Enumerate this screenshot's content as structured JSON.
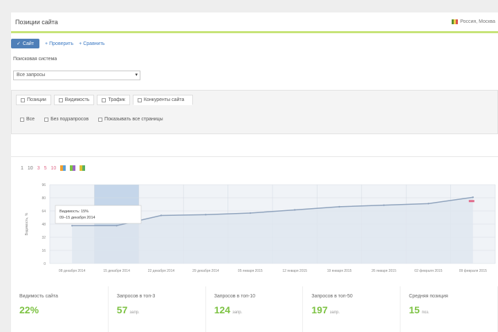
{
  "header": {
    "title": "Позиции сайта",
    "right_text": "Россия, Москва"
  },
  "toolbar": {
    "primary_label": "Сайт",
    "link1_label": "Проверить",
    "link2_label": "Сравнить"
  },
  "filter": {
    "label": "Поисковая система",
    "select_value": "Все запросы",
    "tabs": [
      {
        "label": "Позиции"
      },
      {
        "label": "Видимость"
      },
      {
        "label": "Трафик"
      },
      {
        "label": "Конкуренты сайта"
      }
    ],
    "options": [
      {
        "label": "Все"
      },
      {
        "label": "Без подзапросов"
      },
      {
        "label": "Показывать все страницы"
      }
    ]
  },
  "legend": {
    "items": [
      "1",
      "10",
      "3",
      "5",
      "10"
    ]
  },
  "tooltip": {
    "line1": "Видимость: 15%",
    "line2": "09–15 декабря 2014"
  },
  "chart_data": {
    "type": "area",
    "ylabel": "Видимость, %",
    "ylim": [
      0,
      100
    ],
    "yticks": [
      "0",
      "16",
      "32",
      "48",
      "64",
      "80",
      "96"
    ],
    "x": [
      "08 декабря 2014",
      "15 декабря 2014",
      "22 декабря 2014",
      "29 декабря 2014",
      "05 января 2015",
      "12 января 2015",
      "19 января 2015",
      "26 января 2015",
      "02 февраля 2015",
      "09 февраля 2015"
    ],
    "series": [
      {
        "values": [
          48,
          48,
          61,
          62,
          64,
          68,
          72,
          74,
          76,
          84
        ]
      }
    ],
    "highlight_index": 1,
    "colors": {
      "line": "#8fa3bd",
      "area": "#dfe6ef",
      "highlight": "#c5d6ea",
      "marker": "#e06b8a"
    }
  },
  "stats": [
    {
      "label": "Видимость сайта",
      "value": "22%",
      "unit": ""
    },
    {
      "label": "Запросов в топ-3",
      "value": "57",
      "unit": "запр."
    },
    {
      "label": "Запросов в топ-10",
      "value": "124",
      "unit": "запр."
    },
    {
      "label": "Запросов в топ-50",
      "value": "197",
      "unit": "запр."
    },
    {
      "label": "Средняя позиция",
      "value": "15",
      "unit": "поз."
    }
  ],
  "colors": {
    "accent_green": "#c6e377",
    "primary_blue": "#4f7fb8",
    "stat_green": "#7cc242"
  }
}
